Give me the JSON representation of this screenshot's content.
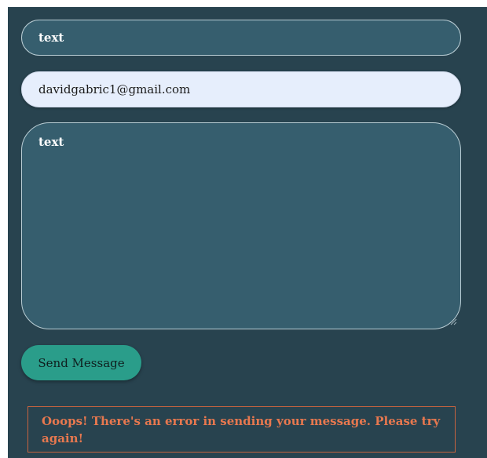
{
  "form": {
    "name_value": "text",
    "email_value": "davidgabric1@gmail.com",
    "message_value": "text",
    "send_label": "Send Message",
    "error_message": "Ooops! There's an error in sending your message. Please try again!"
  },
  "colors": {
    "panel_bg": "#28434f",
    "field_bg": "#365e6e",
    "email_bg": "#e6eefc",
    "button_bg": "#2a9d8a",
    "error_text": "#e7784f"
  }
}
